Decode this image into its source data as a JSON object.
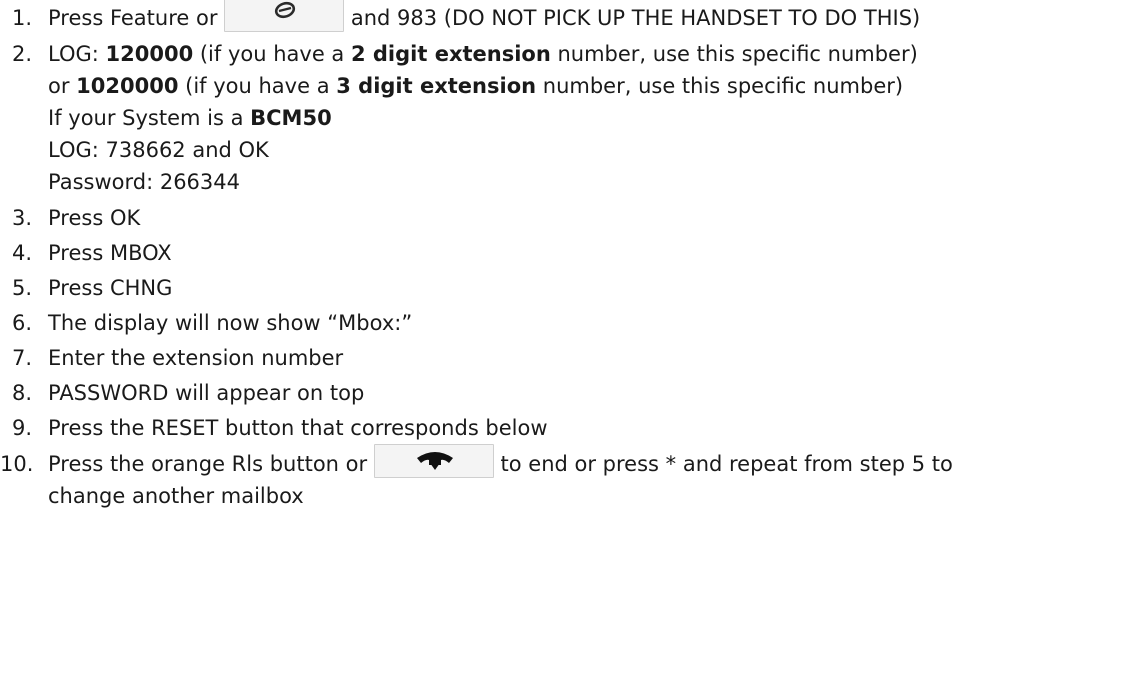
{
  "steps": [
    {
      "num": "1.",
      "pre": "Press Feature or",
      "icon": "feature-key-icon",
      "post": "and 983 (DO NOT PICK UP THE HANDSET TO DO THIS)"
    },
    {
      "num": "2.",
      "l1": {
        "a": "LOG: ",
        "b": "120000",
        "c": " (if you have a ",
        "d": "2 digit extension",
        "e": " number, use this specific number)"
      },
      "l2": {
        "a": "or ",
        "b": "1020000",
        "c": " (if you have a ",
        "d": "3 digit extension",
        "e": " number, use this specific number)"
      },
      "l3": {
        "a": "If your System is a ",
        "b": "BCM50"
      },
      "l4": "LOG: 738662 and OK",
      "l5": "Password: 266344"
    },
    {
      "num": "3.",
      "text": "Press OK"
    },
    {
      "num": "4.",
      "text": "Press MBOX"
    },
    {
      "num": "5.",
      "text": "Press CHNG"
    },
    {
      "num": "6.",
      "text": "The display will now show “Mbox:”"
    },
    {
      "num": "7.",
      "text": "Enter the extension number"
    },
    {
      "num": "8.",
      "text": "PASSWORD will appear on top"
    },
    {
      "num": "9.",
      "text": "Press the RESET button that corresponds below"
    },
    {
      "num": "10.",
      "pre": "Press the orange Rls button or",
      "icon": "release-key-icon",
      "post": "to end or press * and repeat from step 5 to",
      "l2": "change another mailbox"
    }
  ],
  "colors": {
    "text": "#1a1a1a",
    "key_bg": "#f4f4f4",
    "key_border": "#cfcfcf"
  }
}
